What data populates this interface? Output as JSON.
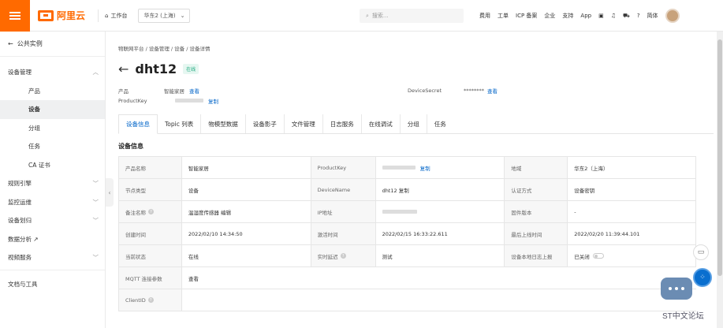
{
  "header": {
    "logo_text": "阿里云",
    "workspace": "工作台",
    "region": "华东2 (上海)",
    "search_placeholder": "搜索...",
    "links": [
      "费用",
      "工单",
      "ICP 备案",
      "企业",
      "支持",
      "App"
    ],
    "language": "简体"
  },
  "sidebar": {
    "back_label": "公共实例",
    "items": [
      {
        "label": "设备管理",
        "chevron": "^"
      },
      {
        "label": "产品"
      },
      {
        "label": "设备"
      },
      {
        "label": "分组"
      },
      {
        "label": "任务"
      },
      {
        "label": "CA 证书"
      },
      {
        "label": "规则引擎",
        "chevron": "v"
      },
      {
        "label": "监控运维",
        "chevron": "v"
      },
      {
        "label": "设备划归",
        "chevron": "v"
      },
      {
        "label": "数据分析 ↗"
      },
      {
        "label": "视频服务",
        "chevron": "v"
      },
      {
        "label": "文档与工具"
      }
    ]
  },
  "main": {
    "breadcrumb": "物联网平台  /  设备管理  /  设备  /  设备详情",
    "device_name": "dht12",
    "status_badge": "在线",
    "product_label": "产品",
    "product_value": "智能家居",
    "view_link": "查看",
    "productkey_label": "ProductKey",
    "copy_link": "复制",
    "secret_label": "DeviceSecret",
    "secret_value": "********",
    "tabs": [
      "设备信息",
      "Topic 列表",
      "物模型数据",
      "设备影子",
      "文件管理",
      "日志服务",
      "在线调试",
      "分组",
      "任务"
    ],
    "section_title": "设备信息",
    "grid": [
      [
        "产品名称",
        "智能家居",
        "ProductKey",
        "复制",
        "地域",
        "华东2（上海）"
      ],
      [
        "节点类型",
        "设备",
        "DeviceName",
        "dht12  复制",
        "认证方式",
        "设备密钥"
      ],
      [
        "备注名称",
        "温湿度传感器  编辑",
        "IP地址",
        "",
        "固件版本",
        "-"
      ],
      [
        "创建时间",
        "2022/02/10 14:34:50",
        "激活时间",
        "2022/02/15 16:33:22.611",
        "最后上线时间",
        "2022/02/20 11:39:44.101"
      ],
      [
        "当前状态",
        "在线",
        "实时延迟",
        "测试",
        "设备本地日志上报",
        "已关闭"
      ],
      [
        "MQTT 连接参数",
        "查看",
        "",
        "",
        "",
        ""
      ],
      [
        "ClientID",
        "",
        "",
        "",
        "",
        ""
      ]
    ]
  },
  "watermark": "ST中文论坛"
}
